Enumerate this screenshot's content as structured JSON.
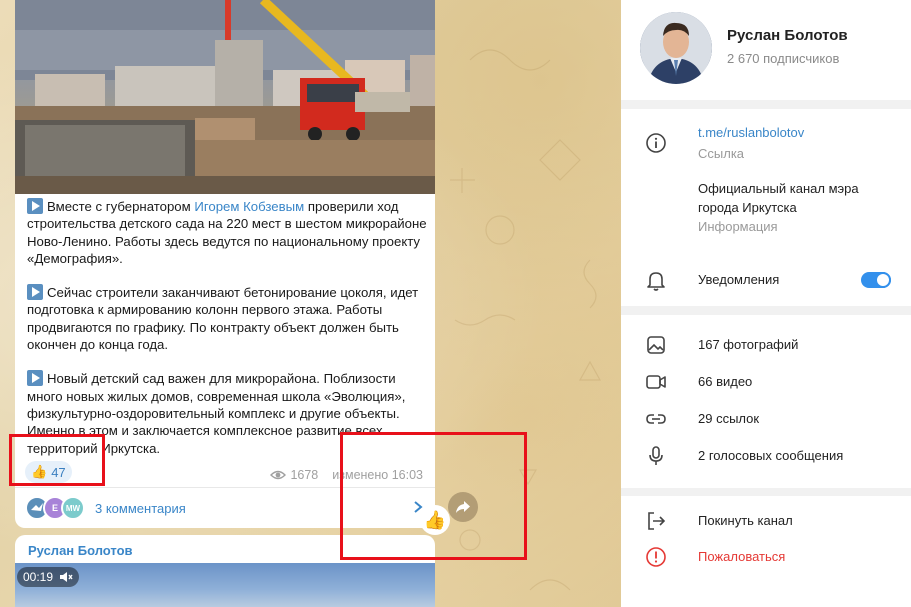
{
  "post": {
    "paragraphs": [
      {
        "prefix": "Вместе с губернатором ",
        "link": "Игорем Кобзевым",
        "suffix": " проверили ход строительства детского сада на 220 мест в шестом микрорайоне Ново-Ленино. Работы здесь ведутся по национальному проекту «Демография»."
      },
      {
        "text": "Сейчас строители заканчивают бетонирование цоколя, идет подготовка к армированию колонн первого этажа. Работы продвигаются по графику. По контракту объект должен быть окончен до конца года."
      },
      {
        "text": "Новый детский сад важен для микрорайона. Поблизости много новых жилых домов, современная школа «Эволюция», физкультурно-оздоровительный комплекс и другие объекты. Именно в этом и заключается комплексное развитие всех территорий Иркутска."
      }
    ],
    "reaction": {
      "icon": "thumbs-up-icon",
      "count": "47"
    },
    "views": "1678",
    "edited_time": "изменено 16:03",
    "comments_label": "3 комментария",
    "commenter_avatars": [
      {
        "initials": "",
        "color": "#5b8fb9"
      },
      {
        "initials": "E",
        "color": "#a883d8"
      },
      {
        "initials": "MW",
        "color": "#7ccbcc"
      }
    ]
  },
  "next_post": {
    "author": "Руслан Болотов",
    "video_duration": "00:19"
  },
  "side_buttons": {
    "react_icon": "thumbs-up-icon",
    "share_icon": "share-arrow-icon"
  },
  "channel": {
    "name": "Руслан Болотов",
    "subscribers": "2 670 подписчиков",
    "link": "t.me/ruslanbolotov",
    "link_caption": "Ссылка",
    "description": "Официальный канал мэра города Иркутска",
    "description_caption": "Информация",
    "notifications_label": "Уведомления",
    "notifications_on": true
  },
  "media": {
    "photos": "167 фотографий",
    "videos": "66 видео",
    "links": "29 ссылок",
    "voice": "2 голосовых сообщения"
  },
  "actions": {
    "leave": "Покинуть канал",
    "report": "Пожаловаться"
  },
  "colors": {
    "accent": "#3390ec",
    "link": "#3a86c8",
    "danger": "#e53935",
    "highlight_box": "#e8101a"
  }
}
